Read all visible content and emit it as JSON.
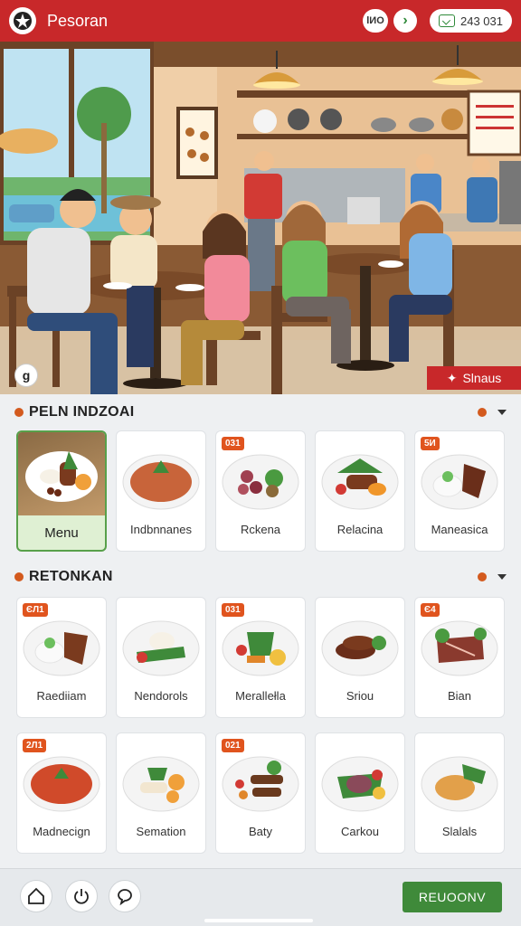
{
  "header": {
    "title": "Pesoran",
    "badge_text": "lИO",
    "counter_text": "243 031"
  },
  "hero": {
    "tag_text": "Slnaus",
    "badge_letter": "g"
  },
  "section1": {
    "title": "PELN INDZOAI",
    "items": [
      {
        "label": "Menu",
        "num": ""
      },
      {
        "label": "Indbnnanes",
        "num": ""
      },
      {
        "label": "Rckena",
        "num": "031"
      },
      {
        "label": "Relacina",
        "num": ""
      },
      {
        "label": "Maneasica",
        "num": "5И"
      }
    ]
  },
  "section2": {
    "title": "RETONKAN",
    "row1": [
      {
        "label": "Raediiam",
        "num": "ЄЛ1"
      },
      {
        "label": "Nendorols",
        "num": ""
      },
      {
        "label": "Merallełla",
        "num": "031"
      },
      {
        "label": "Sriou",
        "num": ""
      },
      {
        "label": "Bian",
        "num": "Є4"
      }
    ],
    "row2": [
      {
        "label": "Madnecign",
        "num": "2Л1"
      },
      {
        "label": "Semation",
        "num": ""
      },
      {
        "label": "Baty",
        "num": "021"
      },
      {
        "label": "Carkou",
        "num": ""
      },
      {
        "label": "Slalals",
        "num": ""
      }
    ]
  },
  "footer": {
    "primary_label": "REUOONV"
  },
  "icons": {
    "logo": "logo-icon",
    "next": "chevron-right-icon",
    "counter": "ticket-icon",
    "home": "home-icon",
    "power": "power-icon",
    "chat": "chat-icon",
    "section_toggle": "chevron-down-icon"
  },
  "colors": {
    "brand_red": "#c8282a",
    "accent_orange": "#d35a1e",
    "primary_green": "#3f8a3a"
  }
}
